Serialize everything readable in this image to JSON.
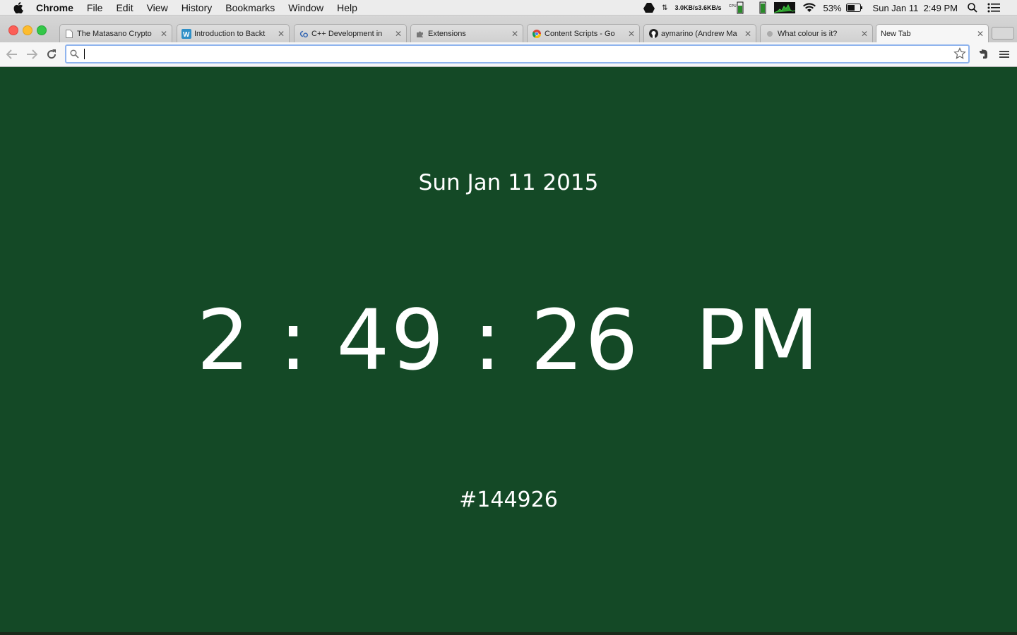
{
  "menubar": {
    "app": "Chrome",
    "items": [
      "File",
      "Edit",
      "View",
      "History",
      "Bookmarks",
      "Window",
      "Help"
    ],
    "status": {
      "net_up": "3.0KB/s",
      "net_down": "3.6KB/s",
      "battery": "53%",
      "datetime": "Sun Jan 11  2:49 PM"
    }
  },
  "tabs": [
    {
      "title": "The Matasano Crypto",
      "icon": "document-icon",
      "active": false
    },
    {
      "title": "Introduction to Backt",
      "icon": "wordpress-icon",
      "active": false
    },
    {
      "title": "C++ Development in",
      "icon": "cdt-icon",
      "active": false
    },
    {
      "title": "Extensions",
      "icon": "puzzle-icon",
      "active": false
    },
    {
      "title": "Content Scripts - Go",
      "icon": "chrome-icon",
      "active": false
    },
    {
      "title": "aymarino (Andrew Ma",
      "icon": "github-icon",
      "active": false
    },
    {
      "title": "What colour is it?",
      "icon": "dot-icon",
      "active": false
    },
    {
      "title": "New Tab",
      "icon": "",
      "active": true
    }
  ],
  "omnibox": {
    "value": "",
    "placeholder": ""
  },
  "page": {
    "date": "Sun Jan 11 2015",
    "time": "2 : 49 : 26  PM",
    "hex": "#144926",
    "background": "#144926"
  },
  "colors": {
    "page_bg": "#144926",
    "text": "#ffffff",
    "omnibox_focus": "#8fb4ee"
  }
}
